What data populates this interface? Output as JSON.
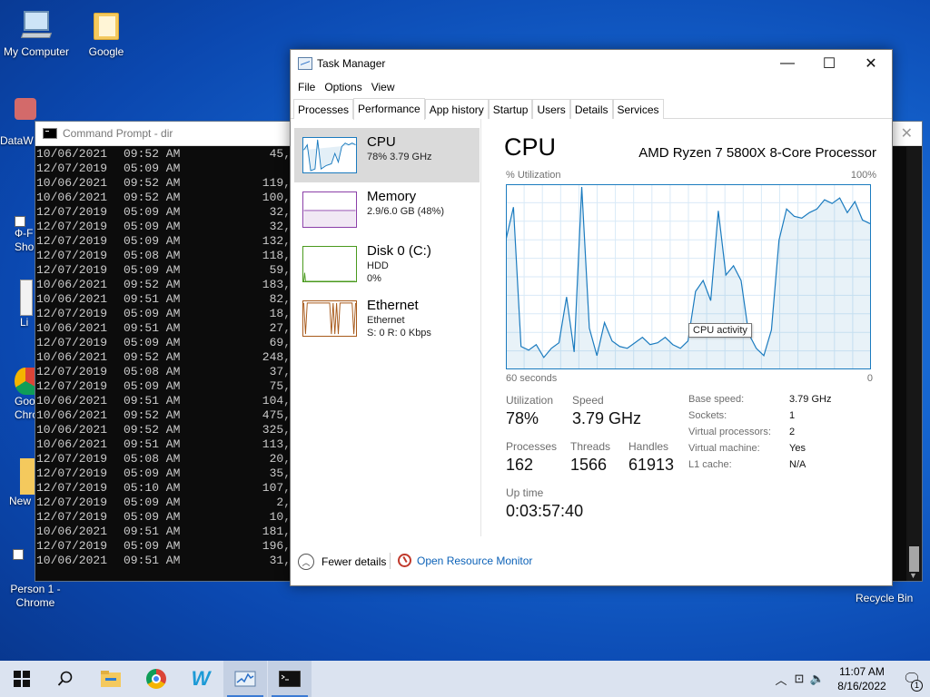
{
  "desktop": {
    "icons": [
      {
        "label": "My Computer"
      },
      {
        "label": "Google"
      },
      {
        "label": "DataW"
      },
      {
        "label": "Ф-F"
      },
      {
        "label": "Shor"
      },
      {
        "label": "Li"
      },
      {
        "label": "Goo"
      },
      {
        "label": "Chro"
      },
      {
        "label": "New"
      },
      {
        "label": "Person 1 -"
      },
      {
        "label": "Chrome"
      }
    ],
    "recycle_bin": "Recycle Bin"
  },
  "cmd": {
    "title": "Command Prompt - dir",
    "close_icon": "✕",
    "lines": [
      {
        "date": "10/06/2021",
        "time": "09:52 AM",
        "size": "45,"
      },
      {
        "date": "12/07/2019",
        "time": "05:09 AM",
        "size": ""
      },
      {
        "date": "10/06/2021",
        "time": "09:52 AM",
        "size": "119,"
      },
      {
        "date": "10/06/2021",
        "time": "09:52 AM",
        "size": "100,"
      },
      {
        "date": "12/07/2019",
        "time": "05:09 AM",
        "size": "32,"
      },
      {
        "date": "12/07/2019",
        "time": "05:09 AM",
        "size": "32,"
      },
      {
        "date": "12/07/2019",
        "time": "05:09 AM",
        "size": "132,"
      },
      {
        "date": "12/07/2019",
        "time": "05:08 AM",
        "size": "118,"
      },
      {
        "date": "12/07/2019",
        "time": "05:09 AM",
        "size": "59,"
      },
      {
        "date": "10/06/2021",
        "time": "09:52 AM",
        "size": "183,"
      },
      {
        "date": "10/06/2021",
        "time": "09:51 AM",
        "size": "82,"
      },
      {
        "date": "12/07/2019",
        "time": "05:09 AM",
        "size": "18,"
      },
      {
        "date": "10/06/2021",
        "time": "09:51 AM",
        "size": "27,"
      },
      {
        "date": "12/07/2019",
        "time": "05:09 AM",
        "size": "69,"
      },
      {
        "date": "10/06/2021",
        "time": "09:52 AM",
        "size": "248,"
      },
      {
        "date": "12/07/2019",
        "time": "05:08 AM",
        "size": "37,"
      },
      {
        "date": "12/07/2019",
        "time": "05:09 AM",
        "size": "75,"
      },
      {
        "date": "10/06/2021",
        "time": "09:51 AM",
        "size": "104,"
      },
      {
        "date": "10/06/2021",
        "time": "09:52 AM",
        "size": "475,"
      },
      {
        "date": "10/06/2021",
        "time": "09:52 AM",
        "size": "325,"
      },
      {
        "date": "10/06/2021",
        "time": "09:51 AM",
        "size": "113,"
      },
      {
        "date": "12/07/2019",
        "time": "05:08 AM",
        "size": "20,"
      },
      {
        "date": "12/07/2019",
        "time": "05:09 AM",
        "size": "35,"
      },
      {
        "date": "12/07/2019",
        "time": "05:10 AM",
        "size": "107,"
      },
      {
        "date": "12/07/2019",
        "time": "05:09 AM",
        "size": "2,"
      },
      {
        "date": "12/07/2019",
        "time": "05:09 AM",
        "size": "10,"
      },
      {
        "date": "10/06/2021",
        "time": "09:51 AM",
        "size": "181,"
      },
      {
        "date": "12/07/2019",
        "time": "05:09 AM",
        "size": "196,"
      },
      {
        "date": "10/06/2021",
        "time": "09:51 AM",
        "size": "31,"
      }
    ]
  },
  "tm": {
    "title": "Task Manager",
    "window_buttons": {
      "minimize": "—",
      "maximize": "☐",
      "close": "✕"
    },
    "menu": [
      "File",
      "Options",
      "View"
    ],
    "tabs": [
      "Processes",
      "Performance",
      "App history",
      "Startup",
      "Users",
      "Details",
      "Services"
    ],
    "active_tab": "Performance",
    "resources": [
      {
        "name": "CPU",
        "sub1": "78%  3.79 GHz",
        "sub2": "",
        "color": "#1b7bbf"
      },
      {
        "name": "Memory",
        "sub1": "2.9/6.0 GB (48%)",
        "sub2": "",
        "color": "#8b3fa8"
      },
      {
        "name": "Disk 0 (C:)",
        "sub1": "HDD",
        "sub2": "0%",
        "color": "#4a9a1e"
      },
      {
        "name": "Ethernet",
        "sub1": "Ethernet",
        "sub2": "S: 0  R: 0 Kbps",
        "color": "#a7591a"
      }
    ],
    "cpu": {
      "title": "CPU",
      "model": "AMD Ryzen 7 5800X 8-Core Processor",
      "util_label": "% Utilization",
      "util_max": "100%",
      "axis_left": "60 seconds",
      "axis_right": "0",
      "tooltip": "CPU activity",
      "stats": {
        "utilization_label": "Utilization",
        "utilization": "78%",
        "speed_label": "Speed",
        "speed": "3.79 GHz",
        "processes_label": "Processes",
        "processes": "162",
        "threads_label": "Threads",
        "threads": "1566",
        "handles_label": "Handles",
        "handles": "61913",
        "uptime_label": "Up time",
        "uptime": "0:03:57:40"
      },
      "specs": [
        {
          "label": "Base speed:",
          "value": "3.79 GHz"
        },
        {
          "label": "Sockets:",
          "value": "1"
        },
        {
          "label": "Virtual processors:",
          "value": "2"
        },
        {
          "label": "Virtual machine:",
          "value": "Yes"
        },
        {
          "label": "L1 cache:",
          "value": "N/A"
        }
      ],
      "history": [
        70,
        88,
        12,
        10,
        13,
        6,
        11,
        14,
        39,
        9,
        99,
        22,
        7,
        25,
        15,
        12,
        11,
        14,
        17,
        13,
        14,
        17,
        13,
        11,
        15,
        42,
        48,
        37,
        86,
        51,
        56,
        48,
        19,
        11,
        7,
        21,
        70,
        87,
        83,
        82,
        85,
        87,
        92,
        90,
        93,
        85,
        91,
        81,
        79
      ]
    },
    "footer": {
      "fewer_details": "Fewer details",
      "resource_monitor": "Open Resource Monitor"
    }
  },
  "taskbar": {
    "time": "11:07 AM",
    "date": "8/16/2022",
    "notification_count": "1"
  }
}
